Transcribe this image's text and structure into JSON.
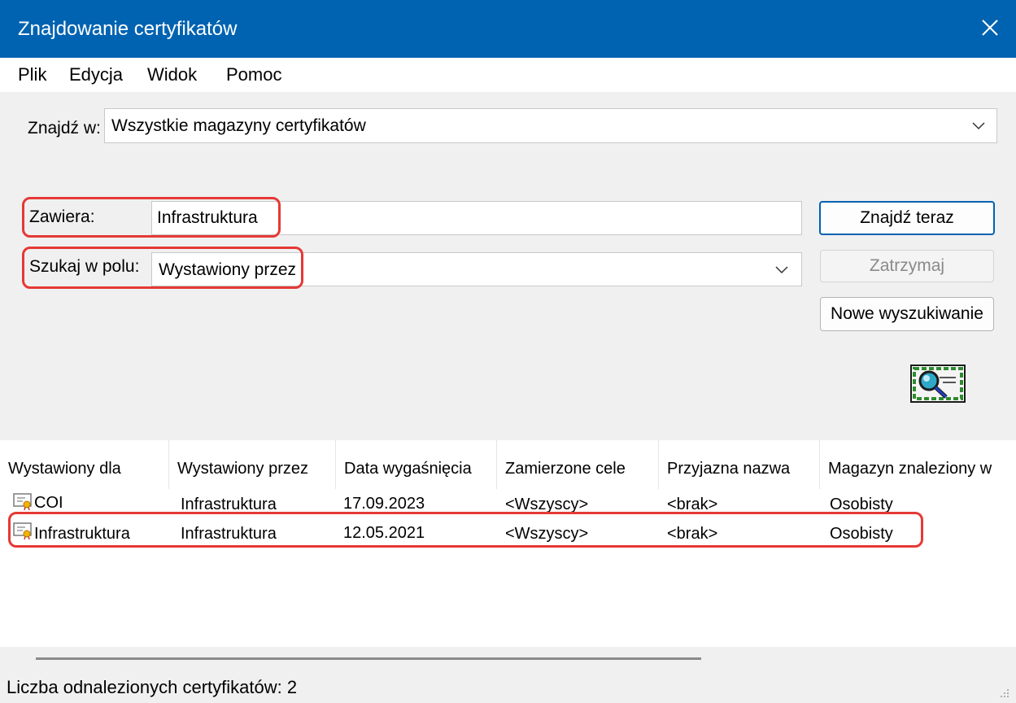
{
  "window": {
    "title": "Znajdowanie certyfikatów"
  },
  "menu": {
    "items": [
      "Plik",
      "Edycja",
      "Widok",
      "Pomoc"
    ]
  },
  "search": {
    "find_in_label": "Znajdź w:",
    "find_in_value": "Wszystkie magazyny certyfikatów",
    "contains_label": "Zawiera:",
    "contains_value": "Infrastruktura",
    "field_label": "Szukaj w polu:",
    "field_value": "Wystawiony przez"
  },
  "buttons": {
    "find_now": "Znajdź teraz",
    "stop": "Zatrzymaj",
    "new_search": "Nowe wyszukiwanie"
  },
  "results": {
    "columns": [
      "Wystawiony dla",
      "Wystawiony przez",
      "Data wygaśnięcia",
      "Zamierzone cele",
      "Przyjazna nazwa",
      "Magazyn znaleziony w"
    ],
    "rows": [
      [
        "COI",
        "Infrastruktura",
        "17.09.2023",
        "<Wszyscy>",
        "<brak>",
        "Osobisty"
      ],
      [
        "Infrastruktura",
        "Infrastruktura",
        "12.05.2021",
        "<Wszyscy>",
        "<brak>",
        "Osobisty"
      ]
    ]
  },
  "status": {
    "text": "Liczba odnalezionych certyfikatów: 2"
  },
  "colors": {
    "titlebar": "#0063b1",
    "highlight": "#e53935"
  }
}
